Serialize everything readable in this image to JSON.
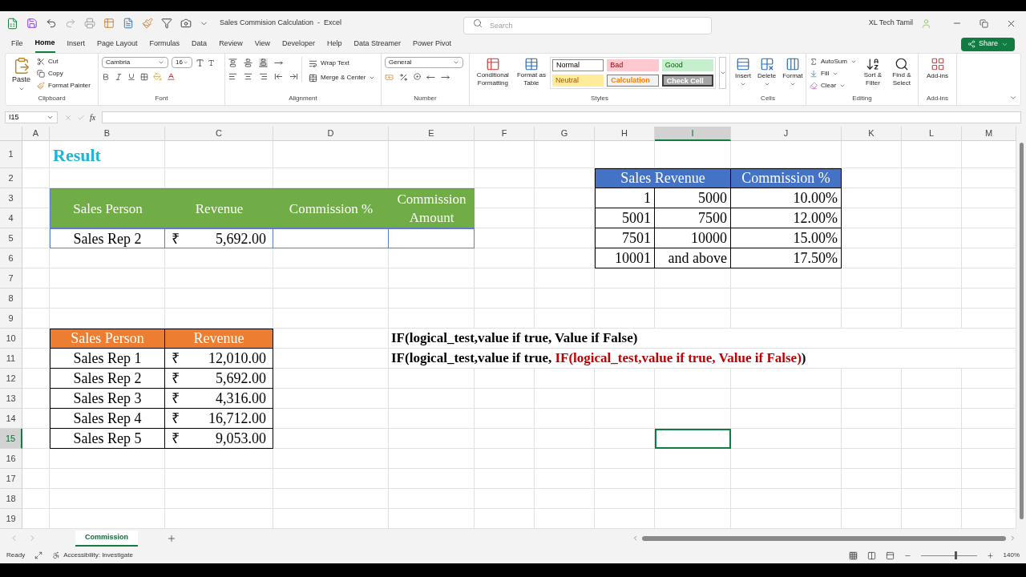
{
  "title_bar": {
    "title": "Sales Commision Calculation  -  Excel",
    "search": {
      "placeholder": "Search"
    },
    "user": "XL Tech Tamil"
  },
  "menu": [
    {
      "label": "File",
      "selected": false
    },
    {
      "label": "Home",
      "selected": true
    },
    {
      "label": "Insert",
      "selected": false
    },
    {
      "label": "Page Layout",
      "selected": false
    },
    {
      "label": "Formulas",
      "selected": false
    },
    {
      "label": "Data",
      "selected": false
    },
    {
      "label": "Review",
      "selected": false
    },
    {
      "label": "View",
      "selected": false
    },
    {
      "label": "Developer",
      "selected": false
    },
    {
      "label": "Help",
      "selected": false
    },
    {
      "label": "Data Streamer",
      "selected": false
    },
    {
      "label": "Power Pivot",
      "selected": false
    }
  ],
  "share": "Share",
  "ribbon": {
    "clipboard": {
      "label": "Clipboard",
      "paste": "Paste",
      "items": [
        "Cut",
        "Copy",
        "Format Painter"
      ]
    },
    "font": {
      "label": "Font",
      "name": "Cambria",
      "size": "16"
    },
    "alignment": {
      "label": "Alignment",
      "wrap": "Wrap Text",
      "merge": "Merge & Center"
    },
    "number": {
      "label": "Number",
      "format": "General"
    },
    "styles": {
      "label": "Styles",
      "buttons": [
        "Conditional Formatting",
        "Format as Table"
      ],
      "cell_styles": [
        {
          "label": "Normal",
          "kind": "normal"
        },
        {
          "label": "Bad",
          "kind": "bad"
        },
        {
          "label": "Good",
          "kind": "good"
        },
        {
          "label": "Neutral",
          "kind": "neutral"
        },
        {
          "label": "Calculation",
          "kind": "calculation"
        },
        {
          "label": "Check Cell",
          "kind": "check"
        }
      ]
    },
    "cells": {
      "label": "Cells",
      "buttons": [
        "Insert",
        "Delete",
        "Format"
      ]
    },
    "editing": {
      "label": "Editing",
      "items": [
        "AutoSum",
        "Fill",
        "Clear"
      ],
      "buttons": [
        "Sort & Filter",
        "Find & Select"
      ]
    },
    "addins": {
      "label": "Add-ins",
      "button": "Add-ins"
    }
  },
  "formula_bar": {
    "name_box": "I15",
    "function_label": "fx"
  },
  "sheet": {
    "columns": [
      {
        "label": "A",
        "selected": false
      },
      {
        "label": "B",
        "selected": false
      },
      {
        "label": "C",
        "selected": false
      },
      {
        "label": "D",
        "selected": false
      },
      {
        "label": "E",
        "selected": false
      },
      {
        "label": "F",
        "selected": false
      },
      {
        "label": "G",
        "selected": false
      },
      {
        "label": "H",
        "selected": false
      },
      {
        "label": "I",
        "selected": true
      },
      {
        "label": "J",
        "selected": false
      },
      {
        "label": "K",
        "selected": false
      },
      {
        "label": "L",
        "selected": false
      },
      {
        "label": "M",
        "selected": false
      }
    ],
    "rows": [
      {
        "label": "1",
        "selected": false
      },
      {
        "label": "2",
        "selected": false
      },
      {
        "label": "3",
        "selected": false
      },
      {
        "label": "4",
        "selected": false
      },
      {
        "label": "5",
        "selected": false
      },
      {
        "label": "6",
        "selected": false
      },
      {
        "label": "7",
        "selected": false
      },
      {
        "label": "8",
        "selected": false
      },
      {
        "label": "9",
        "selected": false
      },
      {
        "label": "10",
        "selected": false
      },
      {
        "label": "11",
        "selected": false
      },
      {
        "label": "12",
        "selected": false
      },
      {
        "label": "13",
        "selected": false
      },
      {
        "label": "14",
        "selected": false
      },
      {
        "label": "15",
        "selected": true
      },
      {
        "label": "16",
        "selected": false
      },
      {
        "label": "17",
        "selected": false
      },
      {
        "label": "18",
        "selected": false
      },
      {
        "label": "19",
        "selected": false
      }
    ],
    "result_title": "Result",
    "result_table": {
      "headers": [
        "Sales Person",
        "Revenue",
        "Commission %",
        "Commission Amount"
      ],
      "rows": [
        {
          "person": "Sales Rep 2",
          "currency": "₹",
          "revenue": "5,692.00"
        }
      ]
    },
    "rate_table": {
      "headers": [
        "Sales Revenue",
        "Commission %"
      ],
      "rows": [
        [
          "1",
          "5000",
          "10.00%"
        ],
        [
          "5001",
          "7500",
          "12.00%"
        ],
        [
          "7501",
          "10000",
          "15.00%"
        ],
        [
          "10001",
          "and above",
          "17.50%"
        ]
      ]
    },
    "sales_table": {
      "headers": [
        "Sales Person",
        "Revenue"
      ],
      "rows": [
        {
          "person": "Sales Rep 1",
          "currency": "₹",
          "revenue": "12,010.00"
        },
        {
          "person": "Sales Rep 2",
          "currency": "₹",
          "revenue": "5,692.00"
        },
        {
          "person": "Sales Rep 3",
          "currency": "₹",
          "revenue": "4,316.00"
        },
        {
          "person": "Sales Rep 4",
          "currency": "₹",
          "revenue": "16,712.00"
        },
        {
          "person": "Sales Rep 5",
          "currency": "₹",
          "revenue": "9,053.00"
        }
      ]
    },
    "formulas": [
      [
        {
          "text": "IF(logical_test,value if true, Value if False)",
          "highlight": false
        }
      ],
      [
        {
          "text": "IF(logical_test,value if true, ",
          "highlight": false
        },
        {
          "text": "IF(logical_test,value if true, Value if False)",
          "highlight": true
        },
        {
          "text": ")",
          "highlight": false
        }
      ]
    ]
  },
  "sheet_tabs": [
    {
      "label": "Commission",
      "selected": true
    }
  ],
  "status_bar": {
    "ready": "Ready",
    "accessibility": "Accessibility: Investigate",
    "zoom": "140%",
    "zoom_slider": {
      "level": 0.6
    }
  }
}
